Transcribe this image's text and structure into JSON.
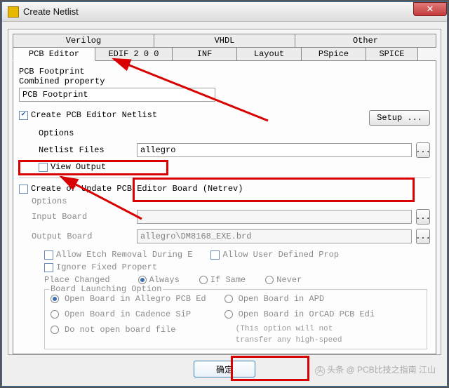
{
  "window": {
    "title": "Create Netlist"
  },
  "tabs": {
    "top": [
      "Verilog",
      "VHDL",
      "Other"
    ],
    "bottom": [
      "PCB Editor",
      "EDIF 2 0 0",
      "INF",
      "Layout",
      "PSpice",
      "SPICE"
    ]
  },
  "section1": {
    "label1": "PCB Footprint",
    "label2": "Combined property",
    "value": "PCB Footprint"
  },
  "create": {
    "checkbox": "Create PCB Editor Netlist",
    "setup_btn": "Setup ...",
    "options": "Options",
    "netlist_files": "Netlist Files",
    "netlist_value": "allegro",
    "view_output": "View Output"
  },
  "update": {
    "checkbox": "Create or Update PCB Editor Board (Netrev)",
    "options": "Options",
    "input_board": "Input Board",
    "output_board": "Output Board",
    "output_value": "allegro\\DM8168_EXE.brd",
    "allow_etch": "Allow Etch Removal During E",
    "allow_user": "Allow User Defined Prop",
    "ignore_fixed": "Ignore Fixed Propert",
    "place_changed": "Place Changed",
    "always": "Always",
    "if_same": "If Same",
    "never": "Never",
    "launch": {
      "title": "Board Launching Option",
      "open_allegro": "Open Board in Allegro PCB Ed",
      "open_cadence": "Open Board in Cadence SiP",
      "do_not_open": "Do not open board file",
      "open_apd": "Open Board in APD",
      "open_orcad": "Open Board in OrCAD PCB Edi",
      "note1": "(This option will not",
      "note2": "transfer any high-speed"
    }
  },
  "footer": {
    "ok": "确定"
  },
  "icons": {
    "close": "✕",
    "browse": "..."
  },
  "watermark": "头条  @ PCB比技之指南 江山"
}
